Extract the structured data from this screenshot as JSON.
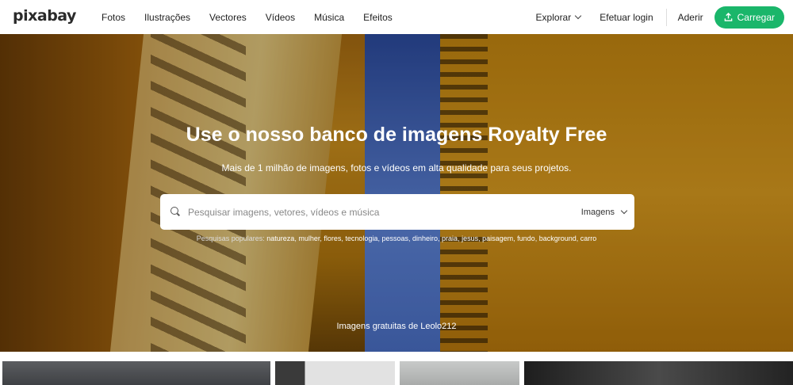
{
  "header": {
    "logo": "pixabay",
    "nav": [
      "Fotos",
      "Ilustrações",
      "Vectores",
      "Vídeos",
      "Música",
      "Efeitos"
    ],
    "explore": "Explorar",
    "login": "Efetuar login",
    "join": "Aderir",
    "upload": "Carregar"
  },
  "hero": {
    "title": "Use o nosso banco de imagens Royalty Free",
    "subtitle": "Mais de 1 milhão de imagens, fotos e vídeos em alta qualidade para seus projetos.",
    "search": {
      "placeholder": "Pesquisar imagens, vetores, vídeos e música",
      "type": "Imagens"
    },
    "popular_label": "Pesquisas populares:",
    "popular": [
      "natureza",
      "mulher",
      "flores",
      "tecnologia",
      "pessoas",
      "dinheiro",
      "praia",
      "jesus",
      "paisagem",
      "fundo",
      "background",
      "carro"
    ],
    "credit_prefix": "Imagens gratuitas de",
    "credit_user": "Leolo212"
  },
  "colors": {
    "accent": "#1ab66a",
    "text": "#222222"
  },
  "thumbnails": [
    {
      "color": "#4a4c50"
    },
    {
      "color": "#d8d8d8"
    },
    {
      "color": "#b7b9b8"
    },
    {
      "color": "#2b2b2b"
    }
  ]
}
